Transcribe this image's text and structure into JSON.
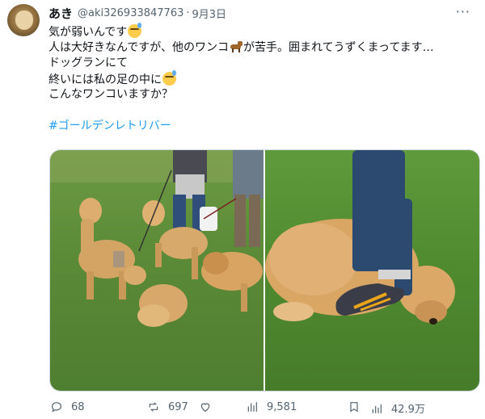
{
  "author": {
    "display_name": "あき",
    "handle": "@aki326933847763",
    "separator": "·",
    "date": "9月3日"
  },
  "more_label": "···",
  "tweet": {
    "lines": [
      "気が弱いんです",
      "人は大好きなんですが、他のワンコ",
      "が苦手。囲まれてうずくまってます…",
      "ドッグランにて",
      "終いには私の足の中に",
      "こんなワンコいますか？"
    ],
    "hashtag": "#ゴールデンレトリバー",
    "emojis": [
      "sweat-smile-emoji",
      "dog-emoji",
      "sleepy-face-emoji"
    ]
  },
  "media": {
    "count": 2,
    "photos": [
      "dogs-surrounding-photo",
      "dog-curled-at-feet-photo"
    ]
  },
  "actions": {
    "reply_count": "68",
    "repost_count": "697",
    "like_count": "",
    "views_count": "9,581",
    "bookmark_count": "",
    "share_count": "42.9万"
  },
  "colors": {
    "text": "#0f1419",
    "secondary": "#536471",
    "link": "#1d9bf0",
    "border": "#cfd9de",
    "grass": "#5c8c38",
    "golden": "#d9a866"
  }
}
